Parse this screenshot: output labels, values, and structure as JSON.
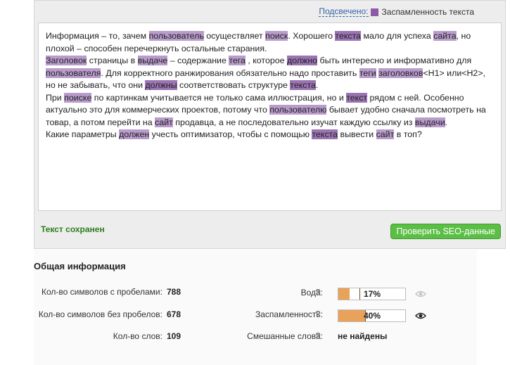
{
  "legend": {
    "link_label": "Подсвечено:",
    "swatch_color": "#8d5aa8",
    "category_label": "Заспамленность текста"
  },
  "editor": {
    "paragraphs": [
      [
        {
          "t": "Информация – то, зачем "
        },
        {
          "t": "пользователь",
          "h": 1
        },
        {
          "t": " осуществляет "
        },
        {
          "t": "поиск",
          "h": 1
        },
        {
          "t": ". Хорошего "
        },
        {
          "t": "текста",
          "h": 2
        },
        {
          "t": " мало для успеха "
        },
        {
          "t": "сайта",
          "h": 1
        },
        {
          "t": ", но плохой – способен перечеркнуть остальные старания."
        }
      ],
      [
        {
          "t": "Заголовок",
          "h": 1
        },
        {
          "t": " страницы в "
        },
        {
          "t": "выдаче",
          "h": 1
        },
        {
          "t": " – содержание "
        },
        {
          "t": "тега",
          "h": 1
        },
        {
          "t": " , которое "
        },
        {
          "t": "должно",
          "h": 2
        },
        {
          "t": " быть интересно и информативно для "
        },
        {
          "t": "пользователя",
          "h": 1
        },
        {
          "t": ". Для корректного ранжирования обязательно надо проставить "
        },
        {
          "t": "теги",
          "h": 1
        },
        {
          "t": " "
        },
        {
          "t": "заголовков",
          "h": 1
        },
        {
          "t": "<H1> или<H2>, но не забывать, что они "
        },
        {
          "t": "должны",
          "h": 2
        },
        {
          "t": " соответствовать структуре "
        },
        {
          "t": "текста",
          "h": 2
        },
        {
          "t": "."
        }
      ],
      [
        {
          "t": "При "
        },
        {
          "t": "поиске",
          "h": 1
        },
        {
          "t": " по картинкам учитывается не только сама иллюстрация, но и "
        },
        {
          "t": "текст",
          "h": 2
        },
        {
          "t": " рядом с ней. Особенно актуально это для коммерческих проектов, потому что "
        },
        {
          "t": "пользователю",
          "h": 1
        },
        {
          "t": " бывает удобно сначала посмотреть на товар, а потом перейти на "
        },
        {
          "t": "сайт",
          "h": 1
        },
        {
          "t": " продавца, а не последовательно изучат каждую ссылку из "
        },
        {
          "t": "выдачи",
          "h": 1
        },
        {
          "t": "."
        }
      ],
      [
        {
          "t": "Какие параметры "
        },
        {
          "t": "должен",
          "h": 1
        },
        {
          "t": " учесть оптимизатор, чтобы с помощью "
        },
        {
          "t": "текста",
          "h": 2
        },
        {
          "t": " вывести "
        },
        {
          "t": "сайт",
          "h": 1
        },
        {
          "t": " в топ?"
        }
      ]
    ]
  },
  "status": {
    "saved": "Текст сохранен"
  },
  "actions": {
    "check_seo": "Проверить SEO-данные"
  },
  "info": {
    "title": "Общая информация",
    "chars_with_spaces_label": "Кол-во символов с пробелами:",
    "chars_with_spaces_value": "788",
    "chars_without_spaces_label": "Кол-во символов без пробелов:",
    "chars_without_spaces_value": "678",
    "words_label": "Кол-во слов:",
    "words_value": "109",
    "water_label": "Вода:",
    "water_value": "17%",
    "water_fraction": 0.17,
    "spam_label": "Заспамленность:",
    "spam_value": "40%",
    "spam_fraction": 0.4,
    "mixed_label": "Смешанные слова:",
    "mixed_value": "не найдены",
    "help_glyph": "?"
  },
  "colors": {
    "meter_fill": "#e8a25a",
    "highlight": "#b99ccc",
    "highlight_strong": "#9b74b3",
    "button": "#5cbf45"
  }
}
